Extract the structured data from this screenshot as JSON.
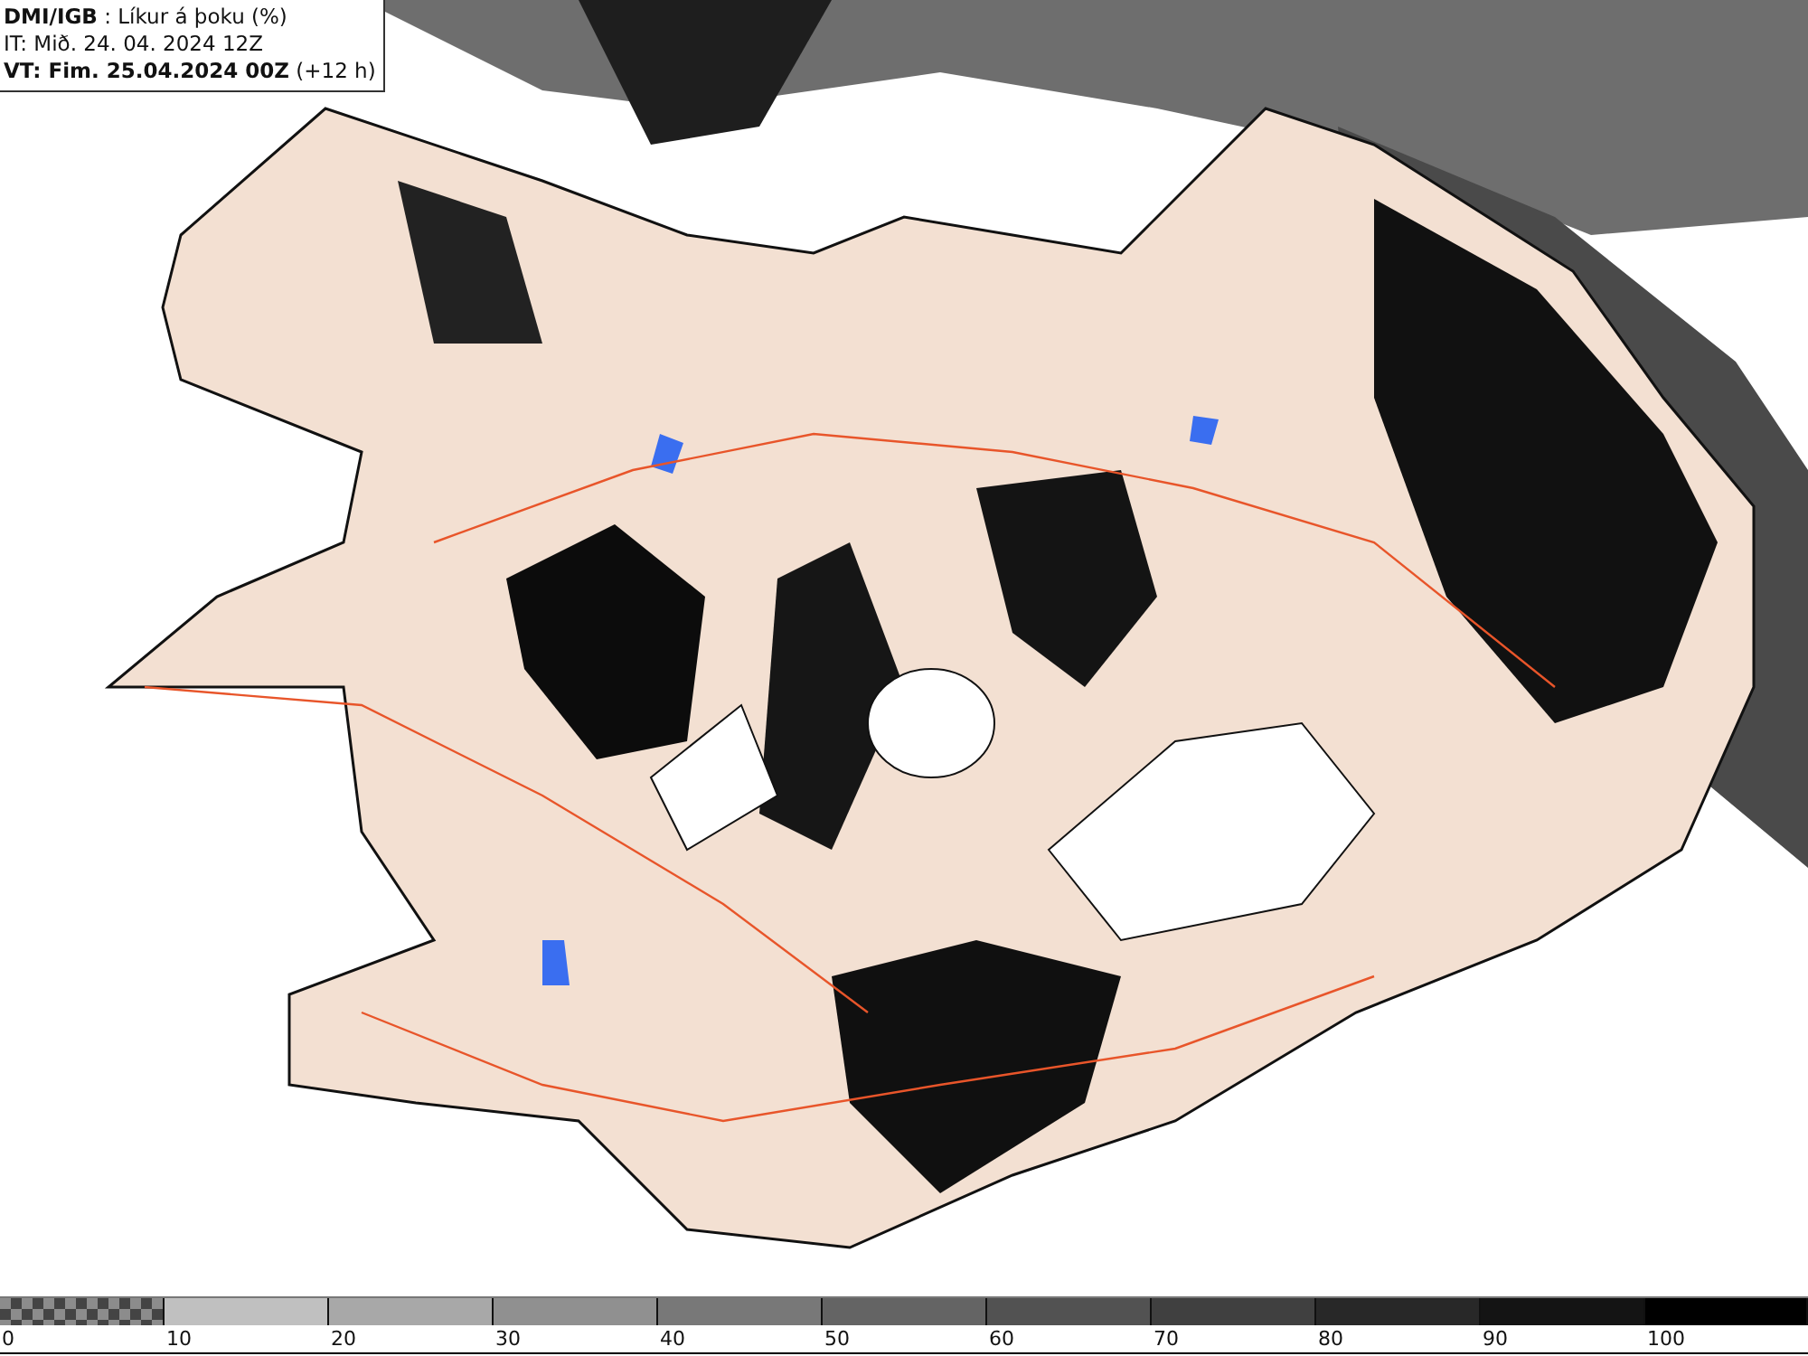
{
  "header": {
    "lines": [
      "**DMI/IGB** : Líkur á þoku (%)",
      "IT: Mið. 24. 04. 2024 12Z",
      "**VT: Fim. 25.04.2024 00Z** (+12 h)"
    ]
  },
  "legend": {
    "bins": [
      {
        "label": "0",
        "kind": "checker",
        "color": "#8c8c8c"
      },
      {
        "label": "10",
        "kind": "solid",
        "color": "#c0c0c0"
      },
      {
        "label": "20",
        "kind": "solid",
        "color": "#a8a8a8"
      },
      {
        "label": "30",
        "kind": "solid",
        "color": "#909090"
      },
      {
        "label": "40",
        "kind": "solid",
        "color": "#787878"
      },
      {
        "label": "50",
        "kind": "solid",
        "color": "#646464"
      },
      {
        "label": "60",
        "kind": "solid",
        "color": "#525252"
      },
      {
        "label": "70",
        "kind": "solid",
        "color": "#404040"
      },
      {
        "label": "80",
        "kind": "solid",
        "color": "#282828"
      },
      {
        "label": "90",
        "kind": "solid",
        "color": "#141414"
      },
      {
        "label": "100",
        "kind": "solid",
        "color": "#000000"
      }
    ]
  }
}
